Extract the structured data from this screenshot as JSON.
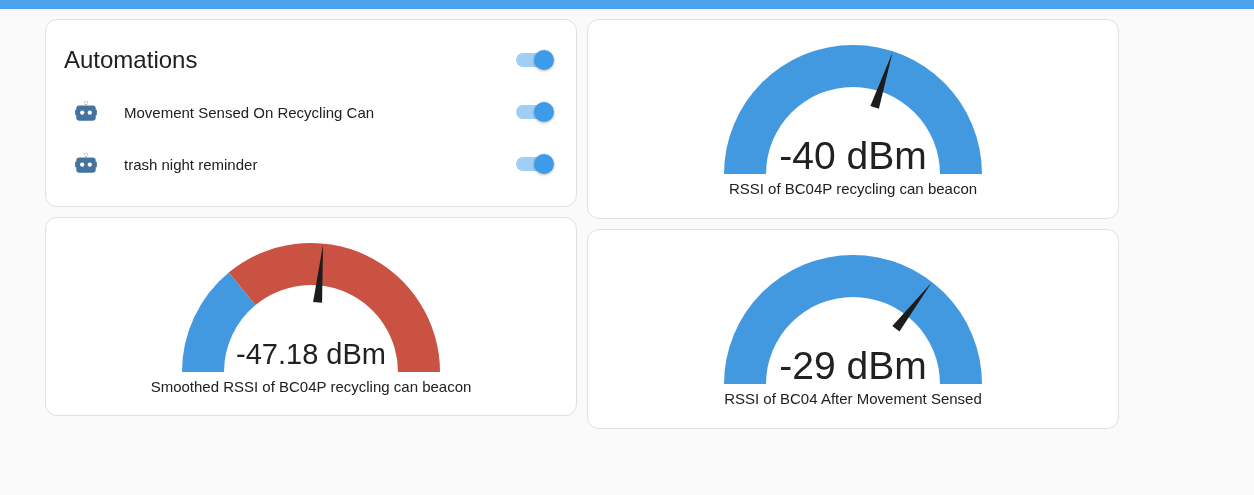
{
  "automations_card": {
    "title": "Automations",
    "on": true,
    "items": [
      {
        "name": "Movement Sensed On Recycling Can",
        "on": true
      },
      {
        "name": "trash night reminder",
        "on": true
      }
    ]
  },
  "gauges": [
    {
      "value": "-47.18 dBm",
      "label": "Smoothed RSSI of BC04P recycling can beacon",
      "segments": [
        {
          "color": "#4399df"
        },
        {
          "color": "#c95242"
        }
      ]
    },
    {
      "value": "-40 dBm",
      "label": "RSSI of BC04P recycling can beacon",
      "segments": [
        {
          "color": "#4399df"
        }
      ]
    },
    {
      "value": "-29 dBm",
      "label": "RSSI of BC04 After Movement Sensed",
      "segments": [
        {
          "color": "#4399df"
        }
      ]
    }
  ]
}
